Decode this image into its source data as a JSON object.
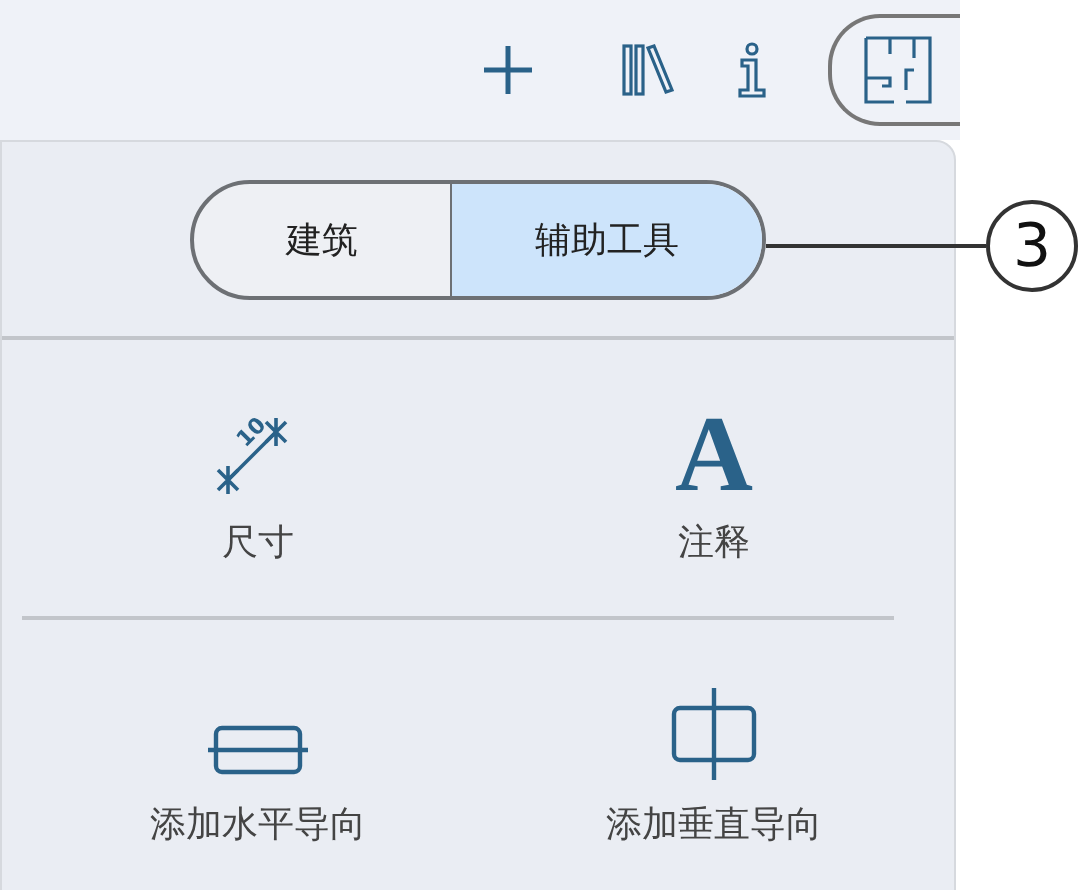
{
  "toolbar": {
    "buttons": [
      {
        "kind": "plus"
      },
      {
        "kind": "library"
      },
      {
        "kind": "info"
      },
      {
        "kind": "floorplan",
        "selected": true
      }
    ]
  },
  "segments": [
    {
      "label": "建筑",
      "selected": false
    },
    {
      "label": "辅助工具",
      "selected": true
    }
  ],
  "callout": {
    "label": "3"
  },
  "tools": [
    {
      "kind": "dimension",
      "label": "尺寸",
      "icon_text": "10"
    },
    {
      "kind": "annotation",
      "label": "注释",
      "icon_text": "A"
    },
    {
      "kind": "hguide",
      "label": "添加水平导向"
    },
    {
      "kind": "vguide",
      "label": "添加垂直导向"
    }
  ]
}
